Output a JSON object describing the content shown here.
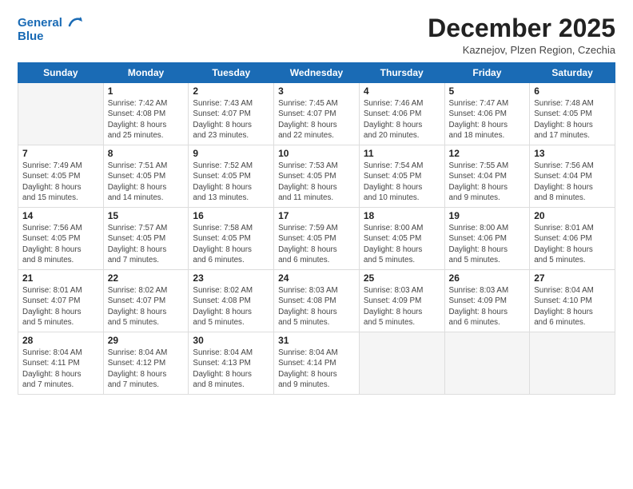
{
  "header": {
    "logo_line1": "General",
    "logo_line2": "Blue",
    "month": "December 2025",
    "location": "Kaznejov, Plzen Region, Czechia"
  },
  "weekdays": [
    "Sunday",
    "Monday",
    "Tuesday",
    "Wednesday",
    "Thursday",
    "Friday",
    "Saturday"
  ],
  "weeks": [
    [
      {
        "day": "",
        "info": ""
      },
      {
        "day": "1",
        "info": "Sunrise: 7:42 AM\nSunset: 4:08 PM\nDaylight: 8 hours\nand 25 minutes."
      },
      {
        "day": "2",
        "info": "Sunrise: 7:43 AM\nSunset: 4:07 PM\nDaylight: 8 hours\nand 23 minutes."
      },
      {
        "day": "3",
        "info": "Sunrise: 7:45 AM\nSunset: 4:07 PM\nDaylight: 8 hours\nand 22 minutes."
      },
      {
        "day": "4",
        "info": "Sunrise: 7:46 AM\nSunset: 4:06 PM\nDaylight: 8 hours\nand 20 minutes."
      },
      {
        "day": "5",
        "info": "Sunrise: 7:47 AM\nSunset: 4:06 PM\nDaylight: 8 hours\nand 18 minutes."
      },
      {
        "day": "6",
        "info": "Sunrise: 7:48 AM\nSunset: 4:05 PM\nDaylight: 8 hours\nand 17 minutes."
      }
    ],
    [
      {
        "day": "7",
        "info": "Sunrise: 7:49 AM\nSunset: 4:05 PM\nDaylight: 8 hours\nand 15 minutes."
      },
      {
        "day": "8",
        "info": "Sunrise: 7:51 AM\nSunset: 4:05 PM\nDaylight: 8 hours\nand 14 minutes."
      },
      {
        "day": "9",
        "info": "Sunrise: 7:52 AM\nSunset: 4:05 PM\nDaylight: 8 hours\nand 13 minutes."
      },
      {
        "day": "10",
        "info": "Sunrise: 7:53 AM\nSunset: 4:05 PM\nDaylight: 8 hours\nand 11 minutes."
      },
      {
        "day": "11",
        "info": "Sunrise: 7:54 AM\nSunset: 4:05 PM\nDaylight: 8 hours\nand 10 minutes."
      },
      {
        "day": "12",
        "info": "Sunrise: 7:55 AM\nSunset: 4:04 PM\nDaylight: 8 hours\nand 9 minutes."
      },
      {
        "day": "13",
        "info": "Sunrise: 7:56 AM\nSunset: 4:04 PM\nDaylight: 8 hours\nand 8 minutes."
      }
    ],
    [
      {
        "day": "14",
        "info": "Sunrise: 7:56 AM\nSunset: 4:05 PM\nDaylight: 8 hours\nand 8 minutes."
      },
      {
        "day": "15",
        "info": "Sunrise: 7:57 AM\nSunset: 4:05 PM\nDaylight: 8 hours\nand 7 minutes."
      },
      {
        "day": "16",
        "info": "Sunrise: 7:58 AM\nSunset: 4:05 PM\nDaylight: 8 hours\nand 6 minutes."
      },
      {
        "day": "17",
        "info": "Sunrise: 7:59 AM\nSunset: 4:05 PM\nDaylight: 8 hours\nand 6 minutes."
      },
      {
        "day": "18",
        "info": "Sunrise: 8:00 AM\nSunset: 4:05 PM\nDaylight: 8 hours\nand 5 minutes."
      },
      {
        "day": "19",
        "info": "Sunrise: 8:00 AM\nSunset: 4:06 PM\nDaylight: 8 hours\nand 5 minutes."
      },
      {
        "day": "20",
        "info": "Sunrise: 8:01 AM\nSunset: 4:06 PM\nDaylight: 8 hours\nand 5 minutes."
      }
    ],
    [
      {
        "day": "21",
        "info": "Sunrise: 8:01 AM\nSunset: 4:07 PM\nDaylight: 8 hours\nand 5 minutes."
      },
      {
        "day": "22",
        "info": "Sunrise: 8:02 AM\nSunset: 4:07 PM\nDaylight: 8 hours\nand 5 minutes."
      },
      {
        "day": "23",
        "info": "Sunrise: 8:02 AM\nSunset: 4:08 PM\nDaylight: 8 hours\nand 5 minutes."
      },
      {
        "day": "24",
        "info": "Sunrise: 8:03 AM\nSunset: 4:08 PM\nDaylight: 8 hours\nand 5 minutes."
      },
      {
        "day": "25",
        "info": "Sunrise: 8:03 AM\nSunset: 4:09 PM\nDaylight: 8 hours\nand 5 minutes."
      },
      {
        "day": "26",
        "info": "Sunrise: 8:03 AM\nSunset: 4:09 PM\nDaylight: 8 hours\nand 6 minutes."
      },
      {
        "day": "27",
        "info": "Sunrise: 8:04 AM\nSunset: 4:10 PM\nDaylight: 8 hours\nand 6 minutes."
      }
    ],
    [
      {
        "day": "28",
        "info": "Sunrise: 8:04 AM\nSunset: 4:11 PM\nDaylight: 8 hours\nand 7 minutes."
      },
      {
        "day": "29",
        "info": "Sunrise: 8:04 AM\nSunset: 4:12 PM\nDaylight: 8 hours\nand 7 minutes."
      },
      {
        "day": "30",
        "info": "Sunrise: 8:04 AM\nSunset: 4:13 PM\nDaylight: 8 hours\nand 8 minutes."
      },
      {
        "day": "31",
        "info": "Sunrise: 8:04 AM\nSunset: 4:14 PM\nDaylight: 8 hours\nand 9 minutes."
      },
      {
        "day": "",
        "info": ""
      },
      {
        "day": "",
        "info": ""
      },
      {
        "day": "",
        "info": ""
      }
    ]
  ]
}
